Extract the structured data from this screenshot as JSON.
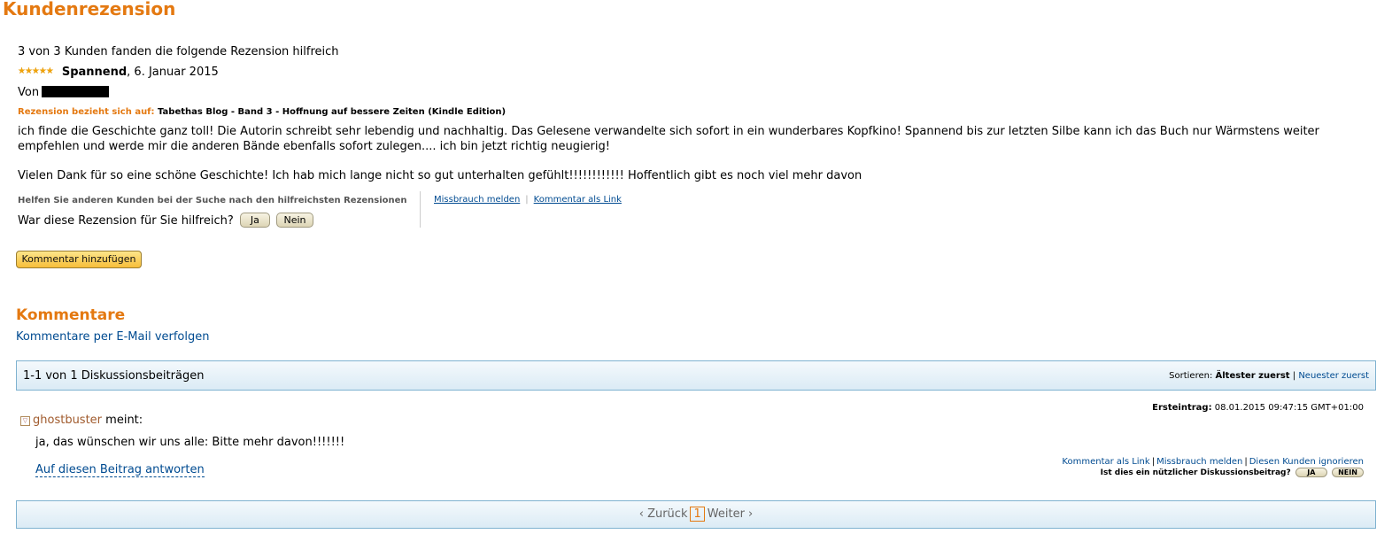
{
  "review": {
    "section_title": "Kundenrezension",
    "helpful_count": "3 von 3 Kunden fanden die folgende Rezension hilfreich",
    "rating": 5,
    "stars_glyph": "★★★★★",
    "title": "Spannend",
    "date": ", 6. Januar 2015",
    "by_label": "Von",
    "refers_label": "Rezension bezieht sich auf:",
    "product": "Tabethas Blog - Band 3 - Hoffnung auf bessere Zeiten (Kindle Edition)",
    "body_p1": "ich finde die Geschichte ganz toll! Die Autorin schreibt sehr lebendig und nachhaltig. Das Gelesene verwandelte sich sofort in ein wunderbares Kopfkino! Spannend bis zur letzten Silbe kann ich das Buch nur Wärmstens weiter empfehlen und werde mir die anderen Bände ebenfalls sofort zulegen.... ich bin jetzt richtig neugierig!",
    "body_p2": "Vielen Dank für so eine schöne Geschichte! Ich hab mich lange nicht so gut unterhalten gefühlt!!!!!!!!!!!! Hoffentlich gibt es noch viel mehr davon",
    "help_others": "Helfen Sie anderen Kunden bei der Suche nach den hilfreichsten Rezensionen",
    "was_helpful": "War diese Rezension für Sie hilfreich?",
    "yes_label": "Ja",
    "no_label": "Nein",
    "report_link": "Missbrauch melden",
    "comment_link": "Kommentar als Link",
    "add_comment": "Kommentar hinzufügen"
  },
  "comments": {
    "title": "Kommentare",
    "follow_email": "Kommentare per E-Mail verfolgen",
    "count_label": "1-1 von 1 Diskussionsbeiträgen",
    "sort_label": "Sortieren:",
    "sort_oldest": "Ältester zuerst",
    "sort_newest": "Neuester zuerst",
    "items": [
      {
        "first_entry_label": "Ersteintrag:",
        "first_entry_value": "08.01.2015 09:47:15 GMT+01:00",
        "collapse_glyph": "▽",
        "user": "ghostbuster",
        "says": "meint:",
        "text": "ja, das wünschen wir uns alle: Bitte mehr davon!!!!!!!",
        "reply": "Auf diesen Beitrag antworten",
        "link_label": "Kommentar als Link",
        "report_label": "Missbrauch melden",
        "ignore_label": "Diesen Kunden ignorieren",
        "useful_question": "Ist dies ein nützlicher Diskussionsbeitrag?",
        "yes": "JA",
        "no": "NEIN"
      }
    ],
    "pager": {
      "prev": "‹ Zurück",
      "current": "1",
      "next": "Weiter ›"
    }
  }
}
